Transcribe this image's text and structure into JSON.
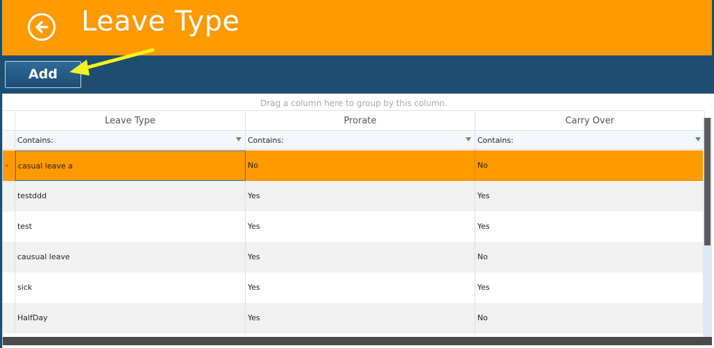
{
  "header": {
    "title": "Leave Type",
    "back_icon": "back-arrow-circle-icon",
    "background_color": "#ff9900"
  },
  "toolbar": {
    "add_label": "Add",
    "background_color": "#1d4e72",
    "annotation_arrow_color": "#f4f41c"
  },
  "grid": {
    "group_panel_text": "Drag a column here to group by this column.",
    "columns": [
      "Leave Type",
      "Prorate",
      "Carry Over"
    ],
    "filter_label": "Contains:",
    "rows": [
      {
        "leave_type": "casual leave a",
        "prorate": "No",
        "carry_over": "No"
      },
      {
        "leave_type": "testddd",
        "prorate": "Yes",
        "carry_over": "Yes"
      },
      {
        "leave_type": "test",
        "prorate": "Yes",
        "carry_over": "Yes"
      },
      {
        "leave_type": "causual leave",
        "prorate": "Yes",
        "carry_over": "No"
      },
      {
        "leave_type": "sick",
        "prorate": "Yes",
        "carry_over": "Yes"
      },
      {
        "leave_type": "HalfDay",
        "prorate": "Yes",
        "carry_over": "No"
      }
    ],
    "selected_row_index": 0,
    "selected_color": "#ff9900"
  }
}
